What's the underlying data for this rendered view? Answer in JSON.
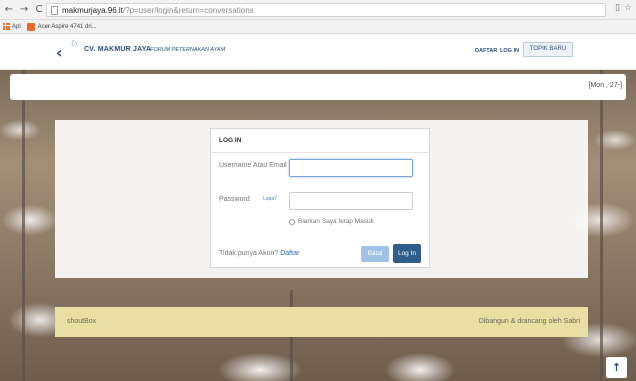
{
  "browser": {
    "nav_back": "←",
    "nav_forward": "→",
    "nav_reload": "C",
    "url_host": "makmurjaya.96.lt",
    "url_path": "/?p=user/login&return=conversations",
    "icons_right": [
      "page-icon",
      "star-icon"
    ],
    "bookmarks": [
      {
        "label": "Apl",
        "icon": "apps-grid-icon"
      },
      {
        "label": "Acer Aspire 4741 dri...",
        "icon": "acer-icon"
      }
    ]
  },
  "header": {
    "back_glyph": "‹",
    "bird_glyph": "♘",
    "brand": "CV. MAKMUR JAYA",
    "tagline": "FORUM PETERNAKAN AYAM",
    "nav_daftar": "DAFTAR",
    "nav_login": "LOG IN",
    "nav_topik": "TOPIK BARU",
    "brand_color": "#2b4c7e"
  },
  "time_bar": {
    "text": "[Mon , 27-]"
  },
  "login": {
    "heading": "LOG IN",
    "username_label": "Username Atau Email",
    "username_value": "",
    "password_label": "Password",
    "forgot_link": "Lupa?",
    "password_value": "",
    "remember_label": "Biarkan Saya tetap Masuk",
    "no_account_text": "Tidak punya Akun?",
    "signup_link": "Daftar",
    "cancel_button": "Batal",
    "login_button": "Log In",
    "button_primary_color": "#2e5e8c",
    "button_secondary_color": "#9fc2e6"
  },
  "footer": {
    "shoutbox": "shoutBox",
    "credit": "Dibangun & drancang oleh Sabri",
    "color": "#eadfa3"
  },
  "scroll_top": {
    "glyph": "↑"
  }
}
